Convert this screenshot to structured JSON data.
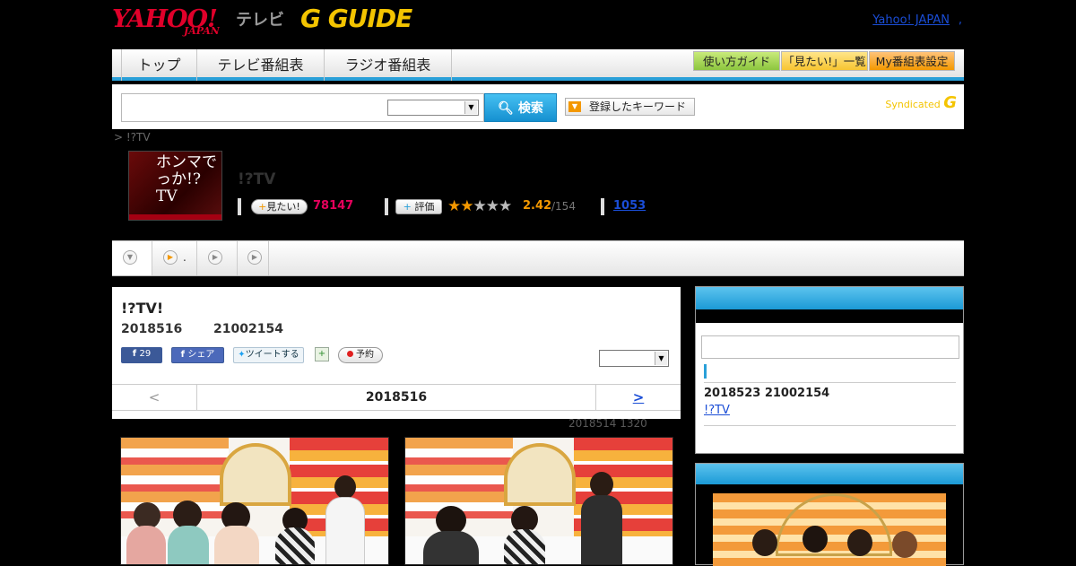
{
  "header": {
    "logo_yahoo": "YAHOO!",
    "logo_japan": "JAPAN",
    "logo_tv": "テレビ",
    "logo_gguide": "G GUIDE",
    "yahoo_japan_link": "Yahoo! JAPAN",
    "yahoo_japan_link_trail": ","
  },
  "nav": {
    "tabs": [
      "トップ",
      "テレビ番組表",
      "ラジオ番組表"
    ],
    "buttons": [
      "使い方ガイド",
      "「見たい!」一覧",
      "My番組表設定"
    ]
  },
  "search": {
    "input_value": "",
    "button_label": "検索",
    "keyword_button": "登録したキーワード",
    "syndicated": "Syndicated"
  },
  "breadcrumb": "> !?TV",
  "program": {
    "thumb_text": "ホンマでっか!?TV",
    "title": "!?TV",
    "want_label": "見たい!",
    "want_count": "78147",
    "rate_label": "評価",
    "rating": "2.42",
    "rating_total": "/154",
    "link_count": "1053",
    "stars_filled": 2,
    "stars_total": 5
  },
  "subtabs": [
    "",
    ".",
    "",
    ""
  ],
  "episode": {
    "title": "!?TV!",
    "date": "2018516",
    "time": "21002154",
    "fb_count": "29",
    "fb_share": "シェア",
    "tweet": "ツイートする",
    "reserve": "予約",
    "select_value": "",
    "pager_prev": "<",
    "pager_date": "2018516",
    "pager_next": ">",
    "updated": "2018514  1320"
  },
  "sidebar": {
    "next_date": "2018523  21002154",
    "next_link": "!?TV  "
  },
  "colors": {
    "accent_blue": "#2aa0d8",
    "want_pink": "#e6005c",
    "rating_orange": "#f39800",
    "link_blue": "#1a4dd6"
  }
}
